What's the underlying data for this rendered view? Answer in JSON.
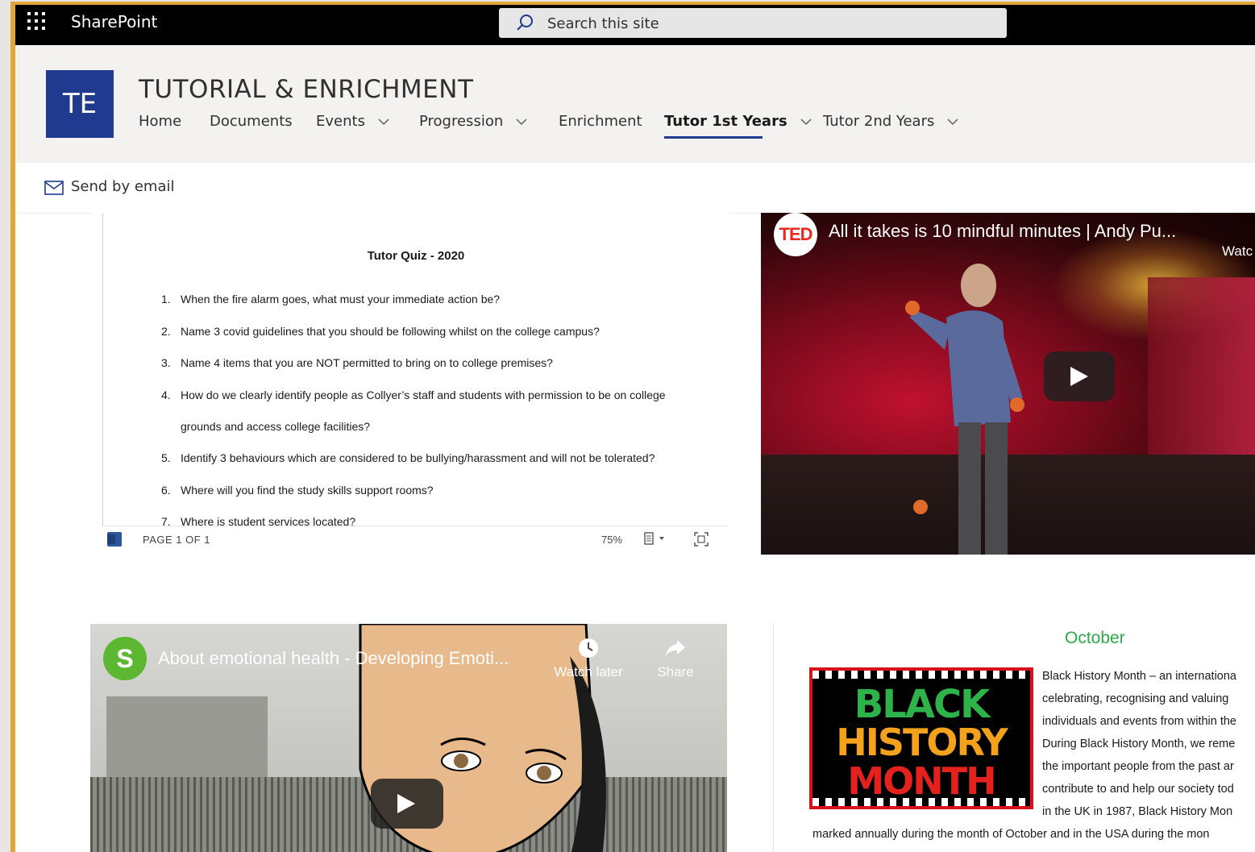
{
  "suite": {
    "app_name": "SharePoint",
    "search_placeholder": "Search this site"
  },
  "site": {
    "logo_text": "TE",
    "title": "TUTORIAL & ENRICHMENT",
    "nav": [
      {
        "label": "Home",
        "has_dropdown": false
      },
      {
        "label": "Documents",
        "has_dropdown": false
      },
      {
        "label": "Events",
        "has_dropdown": true
      },
      {
        "label": "Progression",
        "has_dropdown": true
      },
      {
        "label": "Enrichment",
        "has_dropdown": false
      },
      {
        "label": "Tutor 1st Years",
        "has_dropdown": true,
        "active": true
      },
      {
        "label": "Tutor 2nd Years",
        "has_dropdown": true
      }
    ]
  },
  "command_bar": {
    "send_email_label": "Send by email",
    "icon": "mail-icon"
  },
  "document": {
    "title": "Tutor Quiz - 2020",
    "questions": [
      {
        "num": "1.",
        "text": "When the fire alarm goes, what must your immediate action be?"
      },
      {
        "num": "2.",
        "text": "Name 3 covid guidelines that you should be following whilst on the college campus?"
      },
      {
        "num": "3.",
        "text": "Name 4 items that you are NOT permitted to bring on to college premises?"
      },
      {
        "num": "4.",
        "text": "How do we clearly identify people as Collyer’s staff and students with permission to be on college"
      },
      {
        "num": "",
        "text": "grounds and access college facilities?"
      },
      {
        "num": "5.",
        "text": "Identify 3 behaviours which are considered to be bullying/harassment and will not be tolerated?"
      },
      {
        "num": "6.",
        "text": "Where will you find the study skills support rooms?"
      },
      {
        "num": "7.",
        "text": "Where is student services located?"
      }
    ],
    "page_count": "PAGE 1 OF 1",
    "zoom": "75%"
  },
  "video_ted": {
    "logo": "TED",
    "title": "All it takes is 10 mindful minutes | Andy Pu...",
    "watch_later_partial": "Watc"
  },
  "video_emotional": {
    "logo": "S",
    "title": "About emotional health - Developing Emoti...",
    "watch_later": "Watch later",
    "share": "Share"
  },
  "black_history": {
    "heading": "October",
    "image_words": [
      "BLACK",
      "HISTORY",
      "MONTH"
    ],
    "wrapped_lines": [
      "Black History Month – an internationa",
      "celebrating, recognising and valuing",
      "individuals and events from within the",
      "During Black History Month, we reme",
      "the important people from the past ar",
      "contribute to and help our society tod",
      "in the UK in 1987, Black History Mon"
    ],
    "full_line": "marked annually during the month of October and in the USA during the mon",
    "colors": {
      "heading": "#2ea84a",
      "frame": "#d8121a"
    }
  },
  "colors": {
    "suite_bar": "#000000",
    "accent": "#1f3a8f",
    "frame_border": "#e0a63a"
  }
}
